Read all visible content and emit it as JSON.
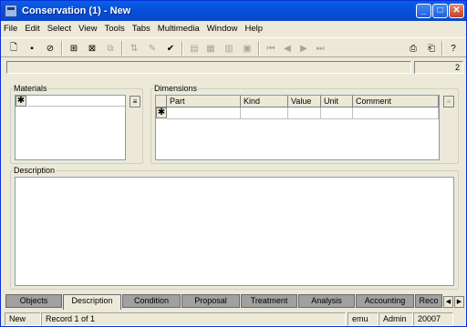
{
  "window": {
    "title": "Conservation (1) - New"
  },
  "menu": [
    "File",
    "Edit",
    "Select",
    "View",
    "Tools",
    "Tabs",
    "Multimedia",
    "Window",
    "Help"
  ],
  "toolbar_icons": [
    "new-record-icon",
    "save-icon",
    "cancel-icon",
    "add-icon",
    "delete-icon",
    "copy-icon",
    "sort-icon",
    "spellcheck-icon",
    "format-icon",
    "layout-icon",
    "grid-icon",
    "attach-icon",
    "first-record-icon",
    "prev-record-icon",
    "next-record-icon",
    "last-record-icon",
    "import-icon",
    "export-icon",
    "help-icon"
  ],
  "info": {
    "count": "2"
  },
  "materials": {
    "label": "Materials",
    "row_marker": "✱"
  },
  "dimensions": {
    "label": "Dimensions",
    "columns": [
      "Part",
      "Kind",
      "Value",
      "Unit",
      "Comment"
    ],
    "row_marker": "✱"
  },
  "description": {
    "label": "Description",
    "value": ""
  },
  "tabs": [
    "Objects",
    "Description",
    "Condition",
    "Proposal",
    "Treatment",
    "Analysis",
    "Accounting",
    "Reco"
  ],
  "active_tab": "Description",
  "status": {
    "mode": "New",
    "record": "Record 1 of 1",
    "user_code": "emu",
    "role": "Admin",
    "number": "20007"
  }
}
